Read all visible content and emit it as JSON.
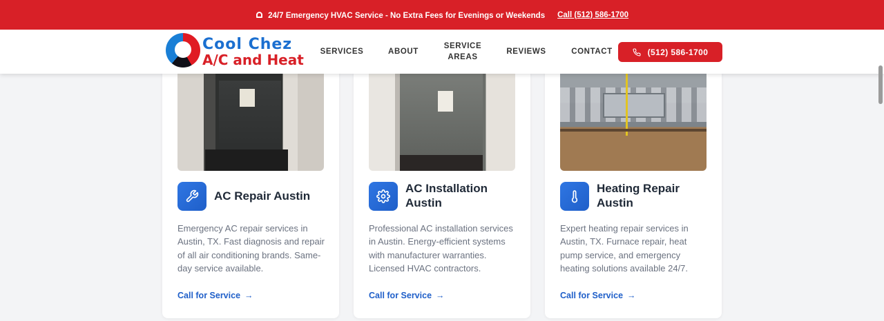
{
  "topbar": {
    "icon": "siren-icon",
    "message": "24/7 Emergency HVAC Service - No Extra Fees for Evenings or Weekends",
    "call_link": "Call (512) 586-1700"
  },
  "header": {
    "logo": {
      "line1": "Cool Chez",
      "line2": "A/C and Heat"
    },
    "nav": {
      "services": "SERVICES",
      "about": "ABOUT",
      "service_areas_line1": "SERVICE",
      "service_areas_line2": "AREAS",
      "reviews": "REVIEWS",
      "contact": "CONTACT"
    },
    "call_button": {
      "label": "(512) 586-1700",
      "icon": "phone-icon"
    }
  },
  "cards": [
    {
      "title": "AC Repair Austin",
      "icon": "wrench-icon",
      "description": "Emergency AC repair services in Austin, TX. Fast diagnosis and repair of all air conditioning brands. Same-day service available.",
      "link": "Call for Service"
    },
    {
      "title": "AC Installation Austin",
      "icon": "gear-icon",
      "description": "Professional AC installation services in Austin. Energy-efficient systems with manufacturer warranties. Licensed HVAC contractors.",
      "link": "Call for Service"
    },
    {
      "title": "Heating Repair Austin",
      "icon": "thermometer-icon",
      "description": "Expert heating repair services in Austin, TX. Furnace repair, heat pump service, and emergency heating solutions available 24/7.",
      "link": "Call for Service"
    }
  ],
  "colors": {
    "brand_red": "#d82027",
    "brand_blue": "#1f5fc9",
    "text_dark": "#1f2937",
    "text_muted": "#6b7280"
  }
}
